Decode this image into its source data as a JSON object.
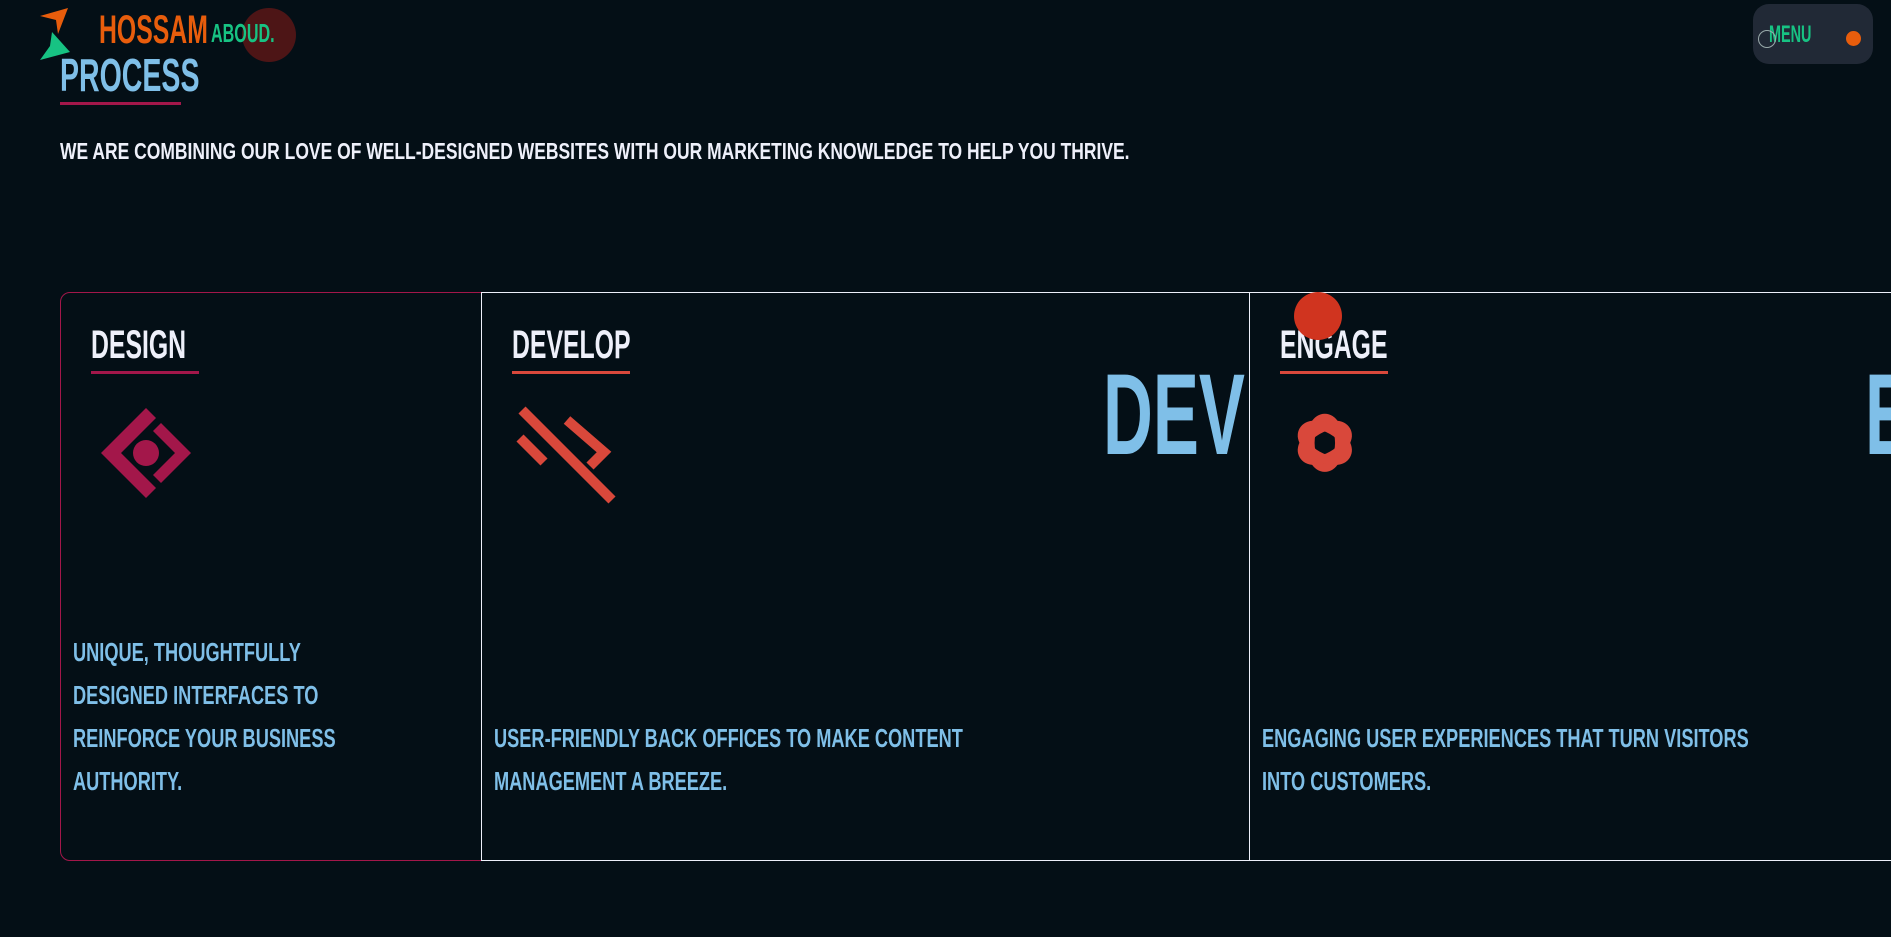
{
  "header": {
    "brand_first": "HOSSAM",
    "brand_second": "ABOUD.",
    "menu_label": "MENU"
  },
  "section": {
    "title": "PROCESS",
    "subtitle": "WE ARE COMBINING OUR LOVE OF WELL-DESIGNED WEBSITES WITH OUR MARKETING KNOWLEDGE TO HELP YOU THRIVE."
  },
  "cards": [
    {
      "title": "DESIGN",
      "icon": "diamond-code-icon",
      "lines": [
        "UNIQUE, THOUGHTFULLY",
        "DESIGNED INTERFACES TO",
        "REINFORCE YOUR BUSINESS",
        "AUTHORITY."
      ]
    },
    {
      "title": "DEVELOP",
      "icon": "code-slash-icon",
      "big": "DEV",
      "lines": [
        "USER-FRIENDLY BACK OFFICES TO MAKE CONTENT",
        "MANAGEMENT A BREEZE."
      ]
    },
    {
      "title": "ENGAGE",
      "icon": "knot-logo-icon",
      "big": "E",
      "lines": [
        "ENGAGING USER EXPERIENCES THAT TURN VISITORS",
        "INTO CUSTOMERS."
      ]
    }
  ],
  "colors": {
    "bg": "#040f16",
    "orange": "#e85d0c",
    "green": "#17c383",
    "blue": "#7fbfe8",
    "crimson": "#a3174a",
    "red": "#d9483b"
  }
}
